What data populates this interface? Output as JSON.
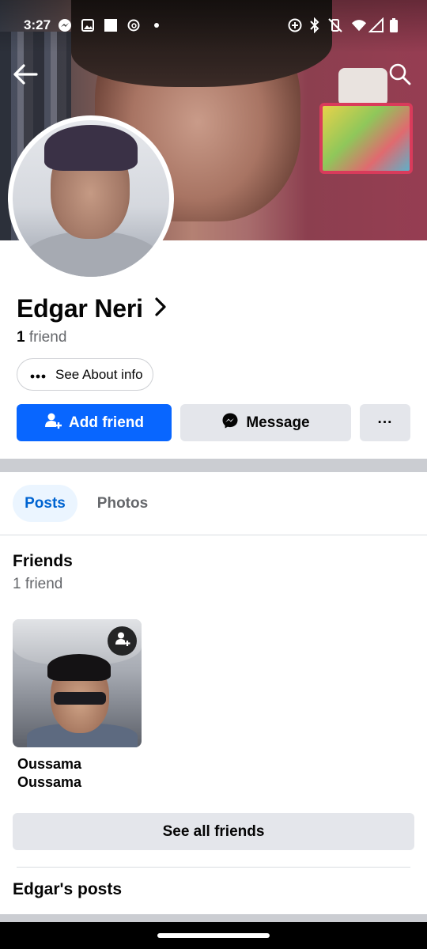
{
  "status_bar": {
    "time": "3:27",
    "icons": [
      "messenger-icon",
      "gallery-icon",
      "square-icon",
      "threads-icon",
      "dot-icon",
      "data-saver-icon",
      "bluetooth-icon",
      "vibrate-off-icon",
      "wifi-icon",
      "signal-icon",
      "battery-icon"
    ]
  },
  "header": {
    "back_icon": "back-arrow-icon",
    "search_icon": "search-icon"
  },
  "profile": {
    "name": "Edgar Neri",
    "friend_count": "1",
    "friend_word": "friend",
    "about_label": "See About info"
  },
  "actions": {
    "add_friend": "Add friend",
    "message": "Message",
    "more": "···"
  },
  "tabs": [
    {
      "label": "Posts",
      "active": true
    },
    {
      "label": "Photos",
      "active": false
    }
  ],
  "friends_section": {
    "title": "Friends",
    "subtitle": "1 friend",
    "friends": [
      {
        "name": "Oussama Oussama"
      }
    ],
    "see_all": "See all friends"
  },
  "posts_section": {
    "title": "Edgar's posts"
  },
  "colors": {
    "primary_blue": "#0866ff",
    "secondary_gray": "#e4e6eb",
    "active_tab_bg": "#ebf5ff",
    "active_tab_text": "#0064d1"
  }
}
